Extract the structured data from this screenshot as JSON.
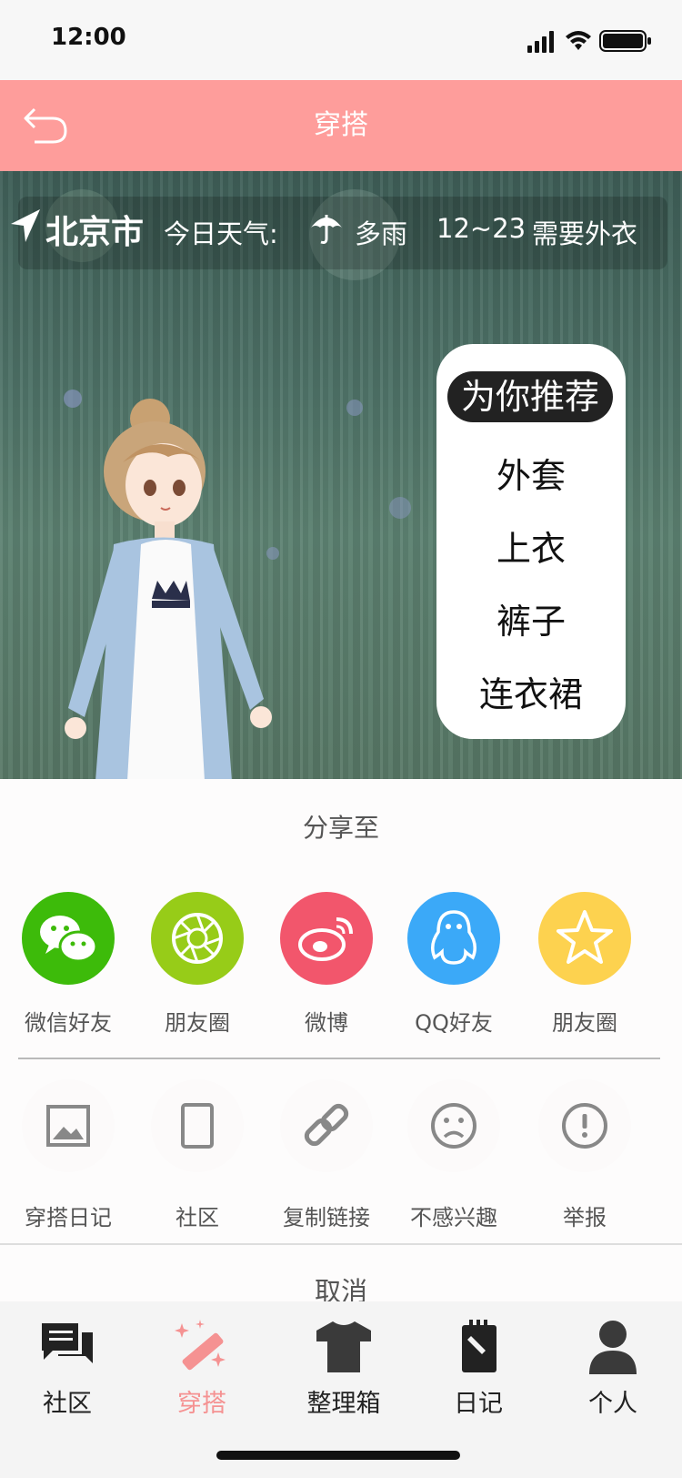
{
  "status_bar": {
    "time": "12:00"
  },
  "nav": {
    "title": "穿搭"
  },
  "weather": {
    "city": "北京市",
    "label": "今日天气:",
    "condition": "多雨",
    "temp_range": "12~23",
    "advice": "需要外衣"
  },
  "categories": [
    "为你推荐",
    "外套",
    "上衣",
    "裤子",
    "连衣裙"
  ],
  "share": {
    "title": "分享至",
    "targets": [
      {
        "label": "微信好友",
        "color": "#3dbb0a",
        "icon": "wechat-icon"
      },
      {
        "label": "朋友圈",
        "color": "#97cc18",
        "icon": "moments-icon"
      },
      {
        "label": "微博",
        "color": "#f2566c",
        "icon": "weibo-icon"
      },
      {
        "label": "QQ好友",
        "color": "#3ba9f8",
        "icon": "qq-icon"
      },
      {
        "label": "朋友圈",
        "color": "#fdd24f",
        "icon": "star-icon"
      }
    ],
    "actions": [
      {
        "label": "穿搭日记",
        "icon": "image-icon"
      },
      {
        "label": "社区",
        "icon": "phone-icon"
      },
      {
        "label": "复制链接",
        "icon": "link-icon"
      },
      {
        "label": "不感兴趣",
        "icon": "sad-face-icon"
      },
      {
        "label": "举报",
        "icon": "alert-icon"
      }
    ],
    "cancel": "取消"
  },
  "tabs": [
    {
      "label": "社区",
      "icon": "chat-icon",
      "active": false
    },
    {
      "label": "穿搭",
      "icon": "magic-wand-icon",
      "active": true
    },
    {
      "label": "整理箱",
      "icon": "tshirt-icon",
      "active": false
    },
    {
      "label": "日记",
      "icon": "notebook-icon",
      "active": false
    },
    {
      "label": "个人",
      "icon": "person-icon",
      "active": false
    }
  ],
  "colors": {
    "accent": "#fe9d9b",
    "active_tab": "#f59292",
    "tab_default": "#222222"
  }
}
